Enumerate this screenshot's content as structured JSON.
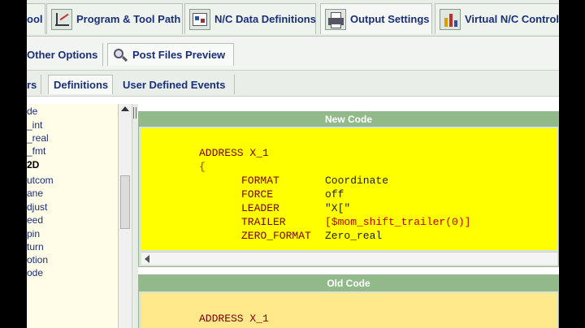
{
  "top_tabs": [
    {
      "label": "ool",
      "icon": "tool-icon"
    },
    {
      "label": "Program & Tool Path",
      "icon": "program-tool-path-icon"
    },
    {
      "label": "N/C Data Definitions",
      "icon": "nc-data-icon"
    },
    {
      "label": "Output Settings",
      "icon": "printer-icon"
    },
    {
      "label": "Virtual N/C Controll",
      "icon": "controller-icon"
    }
  ],
  "sub_tabs": [
    {
      "label": "Other Options"
    },
    {
      "label": "Post Files Preview",
      "icon": "magnifier-icon"
    }
  ],
  "third_tabs": [
    {
      "label": "rs"
    },
    {
      "label": "Definitions"
    },
    {
      "label": "User Defined Events"
    }
  ],
  "tree_items": [
    {
      "label": "de",
      "bold": false
    },
    {
      "label": "_int",
      "bold": false
    },
    {
      "label": "_real",
      "bold": false
    },
    {
      "label": "_fmt",
      "bold": false
    },
    {
      "label": "2D",
      "bold": true
    },
    {
      "label": "utcom",
      "bold": false
    },
    {
      "label": "ane",
      "bold": false
    },
    {
      "label": "djust",
      "bold": false
    },
    {
      "label": "eed",
      "bold": false
    },
    {
      "label": "pin",
      "bold": false
    },
    {
      "label": "turn",
      "bold": false
    },
    {
      "label": "otion",
      "bold": false
    },
    {
      "label": "ode",
      "bold": false
    }
  ],
  "new_code": {
    "header": "New Code",
    "address": "ADDRESS X_1",
    "open_brace": "{",
    "lines": [
      {
        "key": "FORMAT",
        "value": "Coordinate"
      },
      {
        "key": "FORCE",
        "value": "off"
      },
      {
        "key": "LEADER",
        "value": "\"X[\""
      },
      {
        "key": "TRAILER",
        "value": "[$mom_shift_trailer(0)]"
      },
      {
        "key": "ZERO_FORMAT",
        "value": "Zero_real"
      }
    ]
  },
  "old_code": {
    "header": "Old Code",
    "address": "ADDRESS X_1"
  }
}
